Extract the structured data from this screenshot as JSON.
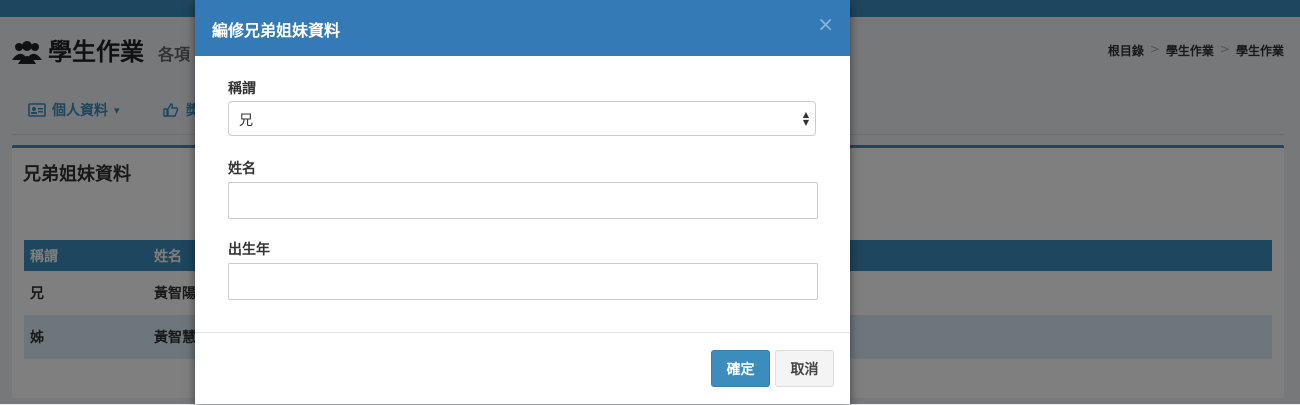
{
  "page": {
    "title": "學生作業",
    "subtitle": "各項",
    "title_icon": "users-icon",
    "breadcrumb": [
      "根目錄",
      "學生作業",
      "學生作業"
    ],
    "breadcrumb_sep": ">",
    "tabs": [
      {
        "label": "個人資料",
        "icon": "id-card-icon",
        "dropdown_caret": "▾"
      },
      {
        "label": "獎",
        "icon": "thumbs-up-icon"
      }
    ],
    "panel": {
      "title": "兄弟姐妹資料",
      "table": {
        "headers": [
          "稱謂",
          "姓名"
        ],
        "rows": [
          [
            "兄",
            "黃智陽"
          ],
          [
            "姊",
            "黃智慧"
          ]
        ]
      }
    }
  },
  "modal": {
    "title": "編修兄弟姐妹資料",
    "close_label": "×",
    "fields": {
      "relation_label": "稱謂",
      "relation_value": "兄",
      "name_label": "姓名",
      "name_value": "",
      "birth_year_label": "出生年",
      "birth_year_value": ""
    },
    "buttons": {
      "confirm": "確定",
      "cancel": "取消"
    }
  },
  "colors": {
    "header_blue": "#337ab7",
    "accent": "#3c8dbc",
    "row_alt": "#d9edf7"
  }
}
